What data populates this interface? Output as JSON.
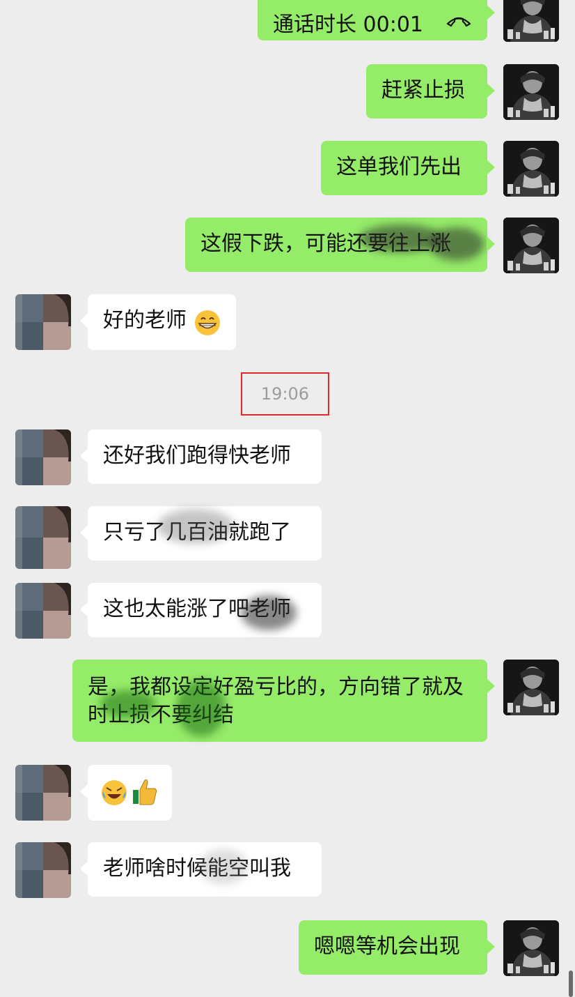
{
  "chat": {
    "call_label": "通话时长 00:01",
    "timestamp": "19:06",
    "messages": {
      "m2": "赶紧止损",
      "m3": "这单我们先出",
      "m4": "这假下跌，可能还要往上涨",
      "m5": "好的老师",
      "m6": "还好我们跑得快老师",
      "m7": "只亏了几百油就跑了",
      "m8": "这也太能涨了吧老师",
      "m9": "是，我都设定好盈亏比的，方向错了就及时止损不要纠结",
      "m11": "老师啥时候能空叫我",
      "m12": "嗯嗯等机会出现"
    }
  },
  "colors": {
    "background": "#ededed",
    "sent_bubble": "#95ec69",
    "received_bubble": "#ffffff",
    "timestamp_highlight": "#e0292b"
  },
  "icons": {
    "call": "phone-hangup-icon",
    "grin_emoji": "grinning-face-emoji",
    "laugh_cry_emoji": "rolling-laughing-emoji",
    "thumbs_up_emoji": "thumbs-up-emoji"
  }
}
